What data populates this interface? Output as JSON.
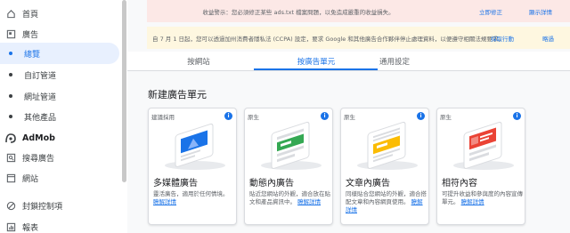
{
  "sidebar": {
    "items": [
      {
        "label": "首頁",
        "icon": "home-icon"
      },
      {
        "label": "廣告",
        "icon": "ads-icon"
      },
      {
        "label": "總覽",
        "active": true
      },
      {
        "label": "自訂管道"
      },
      {
        "label": "網址管道"
      },
      {
        "label": "其他產品"
      },
      {
        "label": "AdMob",
        "icon": "admob-icon"
      },
      {
        "label": "搜尋廣告",
        "icon": "search-ads-icon"
      },
      {
        "label": "網站",
        "icon": "sites-icon"
      },
      {
        "label": "封鎖控制項",
        "icon": "block-icon"
      },
      {
        "label": "報表",
        "icon": "reports-icon"
      }
    ]
  },
  "banners": {
    "red": {
      "message": "收益警示：您必須修正某些 ads.txt 檔案問題，以免造成嚴重的收益損失。",
      "action": "立即修正",
      "dismiss": "顯示詳情"
    },
    "yellow": {
      "message": "自 7 月 1 日起，您可以透過加州消費者隱私法 (CCPA) 設定，要求 Google 和其他廣告合作夥伴停止處理資料，以便遵守相關法規要求。",
      "action": "採取行動",
      "dismiss": "略過"
    }
  },
  "tabs": [
    {
      "label": "按網站"
    },
    {
      "label": "按廣告單元",
      "active": true
    },
    {
      "label": "通用設定"
    }
  ],
  "section_title": "新建廣告單元",
  "cards": [
    {
      "tag": "建議採用",
      "title": "多媒體廣告",
      "desc": "靈活廣告，適用於任何情境。",
      "link": "瞭解詳情",
      "accent": "#1a73e8"
    },
    {
      "tag": "原生",
      "title": "動態內廣告",
      "desc": "貼近您網站的外觀，適合放在貼文和產品資訊中。",
      "link": "瞭解詳情",
      "accent": "#34a853"
    },
    {
      "tag": "原生",
      "title": "文章內廣告",
      "desc": "同樣貼合您網站的外觀，適合搭配文章和內容網頁使用。",
      "link": "瞭解詳情",
      "accent": "#fbbc04"
    },
    {
      "tag": "原生",
      "title": "相符內容",
      "desc": "可提升收益和參與度的內容宣傳單元。",
      "link": "瞭解詳情",
      "accent": "#ea4335"
    }
  ],
  "colors": {
    "primary": "#1a73e8",
    "active_bg": "#e8f0fe",
    "red_banner": "#fce8e6",
    "yellow_banner": "#fef7e0"
  }
}
